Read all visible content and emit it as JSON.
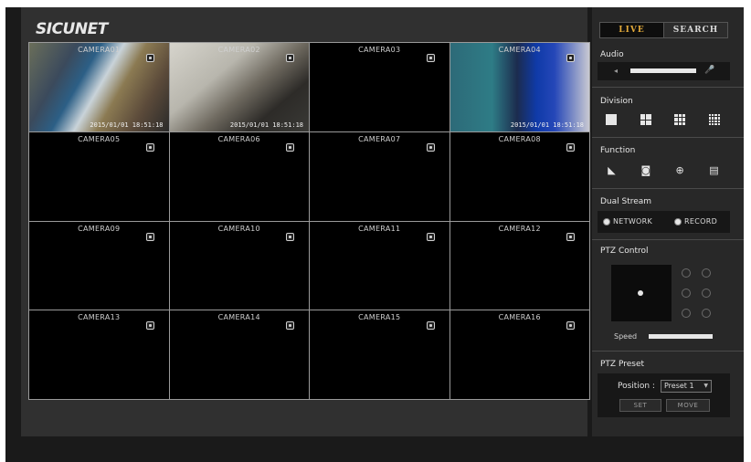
{
  "header": {
    "logo": "SICUNET"
  },
  "tabs": [
    {
      "label": "LIVE",
      "active": true
    },
    {
      "label": "SEARCH",
      "active": false
    }
  ],
  "cameras": [
    {
      "label": "CAMERA01",
      "timestamp": "2015/01/01 18:51:18"
    },
    {
      "label": "CAMERA02",
      "timestamp": "2015/01/01 18:51:18"
    },
    {
      "label": "CAMERA03",
      "timestamp": ""
    },
    {
      "label": "CAMERA04",
      "timestamp": "2015/01/01 18:51:18"
    },
    {
      "label": "CAMERA05",
      "timestamp": ""
    },
    {
      "label": "CAMERA06",
      "timestamp": ""
    },
    {
      "label": "CAMERA07",
      "timestamp": ""
    },
    {
      "label": "CAMERA08",
      "timestamp": ""
    },
    {
      "label": "CAMERA09",
      "timestamp": ""
    },
    {
      "label": "CAMERA10",
      "timestamp": ""
    },
    {
      "label": "CAMERA11",
      "timestamp": ""
    },
    {
      "label": "CAMERA12",
      "timestamp": ""
    },
    {
      "label": "CAMERA13",
      "timestamp": ""
    },
    {
      "label": "CAMERA14",
      "timestamp": ""
    },
    {
      "label": "CAMERA15",
      "timestamp": ""
    },
    {
      "label": "CAMERA16",
      "timestamp": ""
    }
  ],
  "sidebar": {
    "audio": {
      "title": "Audio",
      "level": 1.0
    },
    "division": {
      "title": "Division"
    },
    "function": {
      "title": "Function"
    },
    "dual_stream": {
      "title": "Dual Stream",
      "options": [
        "NETWORK",
        "RECORD"
      ],
      "selected": "NETWORK"
    },
    "ptz_control": {
      "title": "PTZ Control",
      "speed_label": "Speed",
      "speed": 1.0
    },
    "ptz_preset": {
      "title": "PTZ Preset",
      "position_label": "Position :",
      "selected_preset": "Preset 1",
      "set_label": "SET",
      "move_label": "MOVE"
    }
  },
  "colors": {
    "live_tab": "#e2a93a",
    "active_cell_border": "#d8c84a"
  }
}
